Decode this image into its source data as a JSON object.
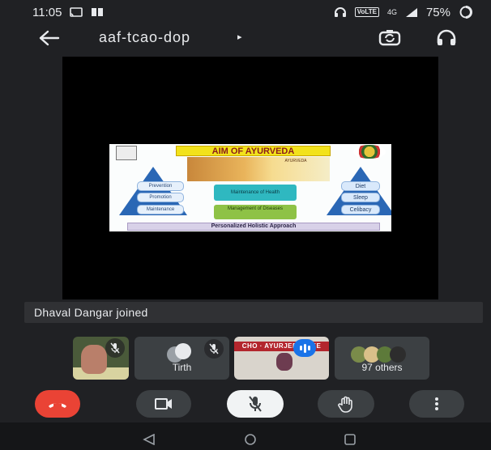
{
  "status_bar": {
    "time": "11:05",
    "network_badge": "VoLTE",
    "network_type": "4G",
    "battery": "75%",
    "icons": [
      "cast-icon",
      "book-icon",
      "headphones-icon",
      "signal-icon",
      "battery-icon"
    ]
  },
  "header": {
    "meeting_code": "aaf-tcao-dop",
    "caret": "▸",
    "icons": [
      "back-arrow-icon",
      "switch-camera-icon",
      "headphones-icon"
    ]
  },
  "presentation": {
    "title": "AIM OF AYURVEDA",
    "painting_caption": "AYURVEDA",
    "left_items": [
      "Prevention",
      "Promotion",
      "Maintenance"
    ],
    "center_items": [
      "Maintenance of Health",
      "Management of Diseases"
    ],
    "right_items": [
      "Diet",
      "Sleep",
      "Celibacy"
    ],
    "footer": "Personalized Holistic Approach"
  },
  "notification": {
    "text": "Dhaval Dangar joined"
  },
  "participants": {
    "tiles": [
      {
        "name": "",
        "muted": true
      },
      {
        "name": "Tirth",
        "muted": true
      },
      {
        "name": "",
        "speaking": true,
        "banner": "CHO · AYURJEEVANEE"
      },
      {
        "name": "97 others"
      }
    ]
  },
  "controls": {
    "icons": [
      "end-call-icon",
      "camera-icon",
      "mic-off-icon",
      "raise-hand-icon",
      "more-options-icon"
    ],
    "colors": {
      "end_call": "#ea4335",
      "mic_off_bg": "#f1f3f4",
      "speaking": "#1a73e8"
    }
  },
  "nav": {
    "icons": [
      "nav-back-icon",
      "nav-home-icon",
      "nav-recents-icon"
    ]
  }
}
